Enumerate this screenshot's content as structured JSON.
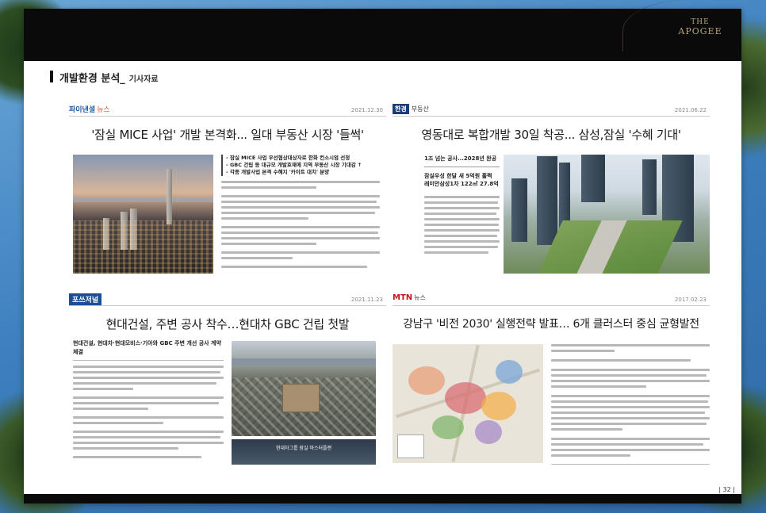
{
  "brand": {
    "the": "THE",
    "name": "APOGEE"
  },
  "section": {
    "title": "개발환경 분석_",
    "subtitle": "기사자료"
  },
  "page": {
    "number": "| 32 |"
  },
  "colors": {
    "sheet_bg": "#ffffff",
    "bar": "#0a0a0a",
    "brand_gold": "#b9a47a"
  },
  "articles": [
    {
      "publisher": "파이낸셜",
      "publisher_suffix": "뉴스",
      "date": "2021.12.30",
      "headline": "'잠실 MICE 사업' 개발 본격화... 일대 부동산 시장 '들썩'",
      "bullets": [
        "- 잠실 MICE 사업 우선협상대상자로 한화 컨소시엄 선정",
        "- GBC 건립 등 대규모 개발호재에 지역 부동산 시장 기대감 ↑",
        "- 각종 개발사업 본격 수혜지 '카이트 대치' 분양"
      ]
    },
    {
      "publisher_box": "한경",
      "publisher_suffix": "부동산",
      "date": "2021.06.22",
      "headline": "영동대로 복합개발 30일 착공... 삼성,잠실 '수혜 기대'",
      "side_heads": [
        "1조 넘는 공사...2028년 완공",
        "잠실우성 한달 새 5억원 훌쩍",
        "래미안삼성1차 122㎡ 27.8억"
      ]
    },
    {
      "publisher": "포쓰저널",
      "date": "2021.11.23",
      "headline": "현대건설, 주변 공사 착수…현대차 GBC 건립 첫발",
      "subhead": "현대건설, 현대차·현대모비스·기아와 GBC 주변 개선 공사 계약 체결",
      "plan_caption": "현대차그룹 잠실 마스터플랜"
    },
    {
      "publisher": "MTN",
      "publisher_suffix": "뉴스",
      "date": "2017.02.23",
      "headline": "강남구 '비전 2030' 실행전략 발표… 6개 클러스터 중심 균형발전"
    }
  ]
}
